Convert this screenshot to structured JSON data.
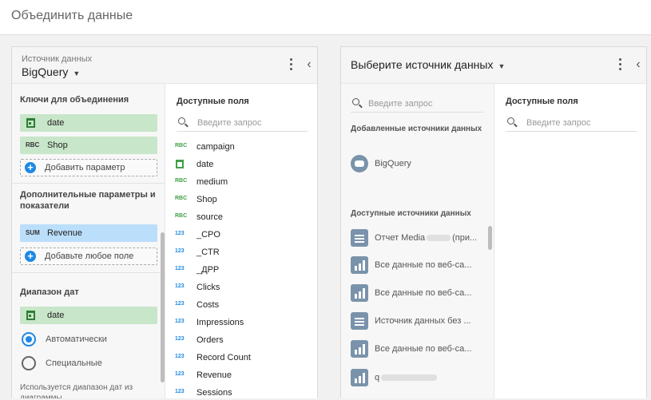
{
  "page": {
    "title": "Объединить данные"
  },
  "left_panel": {
    "source_label": "Источник данных",
    "source_name": "BigQuery",
    "join_keys": {
      "title": "Ключи для объединения",
      "items": [
        {
          "icon": "calendar-icon",
          "label": "date"
        },
        {
          "icon": "abc-text-icon",
          "icon_text": "RBC",
          "label": "Shop"
        }
      ],
      "add_label": "Добавить параметр"
    },
    "extra": {
      "title": "Дополнительные параметры и показатели",
      "items": [
        {
          "icon": "sum-icon",
          "icon_text": "SUM",
          "label": "Revenue"
        }
      ],
      "add_label": "Добавьте любое поле"
    },
    "date_range": {
      "title": "Диапазон дат",
      "field": "date",
      "options": [
        {
          "label": "Автоматически",
          "selected": true
        },
        {
          "label": "Специальные",
          "selected": false
        }
      ],
      "note": "Используется диапазон дат из диаграммы"
    },
    "available": {
      "title": "Доступные поля",
      "search_placeholder": "Введите запрос",
      "fields": [
        {
          "type": "text",
          "badge": "RBC",
          "label": "campaign"
        },
        {
          "type": "date",
          "badge": "",
          "label": "date"
        },
        {
          "type": "text",
          "badge": "RBC",
          "label": "medium"
        },
        {
          "type": "text",
          "badge": "RBC",
          "label": "Shop"
        },
        {
          "type": "text",
          "badge": "RBC",
          "label": "source"
        },
        {
          "type": "number",
          "badge": "123",
          "label": "_CPO"
        },
        {
          "type": "number",
          "badge": "123",
          "label": "_CTR"
        },
        {
          "type": "number",
          "badge": "123",
          "label": "_ДРР"
        },
        {
          "type": "number",
          "badge": "123",
          "label": "Clicks"
        },
        {
          "type": "number",
          "badge": "123",
          "label": "Costs"
        },
        {
          "type": "number",
          "badge": "123",
          "label": "Impressions"
        },
        {
          "type": "number",
          "badge": "123",
          "label": "Orders"
        },
        {
          "type": "number",
          "badge": "123",
          "label": "Record Count"
        },
        {
          "type": "number",
          "badge": "123",
          "label": "Revenue"
        },
        {
          "type": "number",
          "badge": "123",
          "label": "Sessions"
        }
      ]
    }
  },
  "right_panel": {
    "title": "Выберите источник данных",
    "search_placeholder": "Введите запрос",
    "added_title": "Добавленные источники данных",
    "added": [
      {
        "icon": "database-icon",
        "label": "BigQuery"
      }
    ],
    "available_sources_title": "Доступные источники данных",
    "sources": [
      {
        "icon": "table-icon",
        "label_prefix": "Отчет Media",
        "label_suffix": "(при..."
      },
      {
        "icon": "bar-chart-icon",
        "label_prefix": "Все данные по веб-са...",
        "label_suffix": ""
      },
      {
        "icon": "bar-chart-icon",
        "label_prefix": "Все данные по веб-са...",
        "label_suffix": ""
      },
      {
        "icon": "list-icon",
        "label_prefix": "Источник данных без ...",
        "label_suffix": ""
      },
      {
        "icon": "bar-chart-icon",
        "label_prefix": "Все данные по веб-са...",
        "label_suffix": ""
      },
      {
        "icon": "bar-chart-icon",
        "label_prefix": "q",
        "label_suffix": ""
      }
    ],
    "available_fields_title": "Доступные поля",
    "fields_search_placeholder": "Введите запрос"
  }
}
